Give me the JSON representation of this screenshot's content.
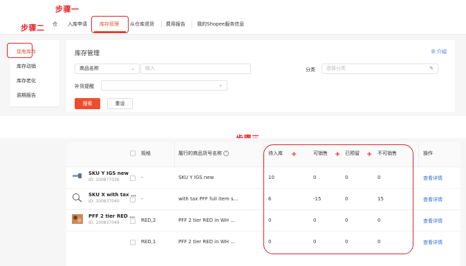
{
  "annotations": {
    "step1": "步骤一",
    "step2": "步骤二",
    "step3": "步骤三"
  },
  "topnav": {
    "tabs": [
      {
        "label": "入库申请"
      },
      {
        "label": "库存管理",
        "active": true
      },
      {
        "label": "从仓库退货"
      },
      {
        "label": "费用报告"
      },
      {
        "label": "我的Shopee服务信息"
      }
    ],
    "partial_left": "仓"
  },
  "sidebar": {
    "items": [
      {
        "label": "现有库存",
        "active": true
      },
      {
        "label": "库存动销"
      },
      {
        "label": "库存老化"
      },
      {
        "label": "逾期报告"
      }
    ]
  },
  "panel": {
    "title": "库存管理",
    "intro_label": "介绍",
    "filter_select": "商品名称",
    "filter_input_placeholder": "输入",
    "category_label": "分类",
    "category_placeholder": "选择分类",
    "replenish_label": "补货提醒",
    "search_button": "搜索",
    "reset_button": "重设"
  },
  "colors": {
    "brand": "#ee4d2d",
    "annotation_red": "#e8262b",
    "link": "#2f6fd6"
  },
  "table": {
    "headers": {
      "spec": "规格",
      "fulfilled_sku": "履行的商品货号名称",
      "pending_inbound": "待入库",
      "sellable": "可销售",
      "reserved": "已预留",
      "unsellable": "不可销售",
      "action": "操作"
    },
    "rows": [
      {
        "name": "SKU Y IGS new",
        "id": "ID: 100877036",
        "spec": "-",
        "fulfilled": "SKU Y IGS new",
        "pending": "10",
        "sellable": "0",
        "reserved": "0",
        "unsellable": "0",
        "action": "查看详情",
        "thumb": "tool"
      },
      {
        "name": "SKU X with tax ...",
        "id": "ID: 100837040",
        "spec": "-",
        "fulfilled": "with tax PFF full item s...",
        "pending": "6",
        "sellable": "-15",
        "reserved": "0",
        "unsellable": "15",
        "action": "查看详情",
        "thumb": "glass"
      },
      {
        "name": "PFF 2 tier RED ...",
        "id": "ID: 100837049",
        "spec": "RED,2",
        "fulfilled": "PFF 2 tier RED in WH ...",
        "pending": "0",
        "sellable": "0",
        "reserved": "0",
        "unsellable": "0",
        "action": "查看详情",
        "thumb": "food"
      },
      {
        "name": "",
        "id": "",
        "spec": "RED,1",
        "fulfilled": "PFF 2 tier RED in WH ...",
        "pending": "0",
        "sellable": "0",
        "reserved": "0",
        "unsellable": "0",
        "action": "查看详情",
        "thumb": ""
      }
    ]
  }
}
